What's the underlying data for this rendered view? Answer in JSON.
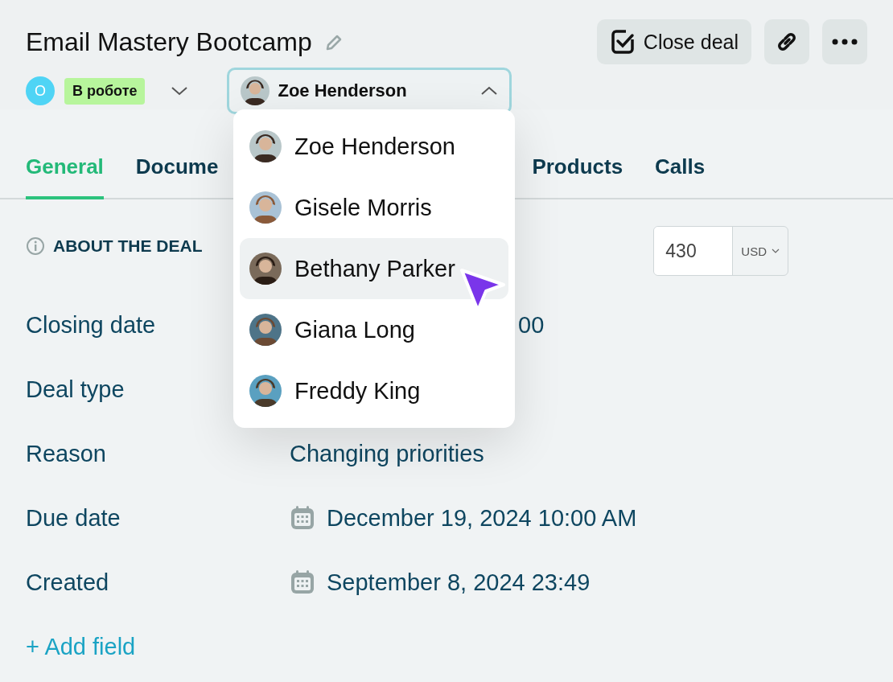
{
  "title": "Email Mastery Bootcamp",
  "status": {
    "avatar_letter": "O",
    "label": "В роботе"
  },
  "assignee": {
    "name": "Zoe Henderson",
    "expanded": true
  },
  "actions": {
    "close_deal": "Close deal"
  },
  "tabs": [
    {
      "label": "General",
      "selected": true
    },
    {
      "label": "Docume",
      "selected": false
    },
    {
      "label": "Products",
      "selected": false
    },
    {
      "label": "Calls",
      "selected": false
    }
  ],
  "section": {
    "title": "ABOUT THE DEAL",
    "amount": "430",
    "currency": "USD"
  },
  "fields": [
    {
      "label": "Closing date",
      "value": "00",
      "kind": "partial"
    },
    {
      "label": "Deal type",
      "kind": "empty"
    },
    {
      "label": "Reason",
      "value": "Changing priorities",
      "kind": "text"
    },
    {
      "label": "Due date",
      "value": "December 19, 2024 10:00 AM",
      "kind": "date"
    },
    {
      "label": "Created",
      "value": "September 8, 2024 23:49",
      "kind": "date"
    }
  ],
  "add_field": "+ Add field",
  "dropdown": [
    {
      "name": "Zoe Henderson",
      "highlighted": false
    },
    {
      "name": "Gisele Morris",
      "highlighted": false
    },
    {
      "name": "Bethany Parker",
      "highlighted": true
    },
    {
      "name": "Giana Long",
      "highlighted": false
    },
    {
      "name": "Freddy King",
      "highlighted": false
    }
  ]
}
